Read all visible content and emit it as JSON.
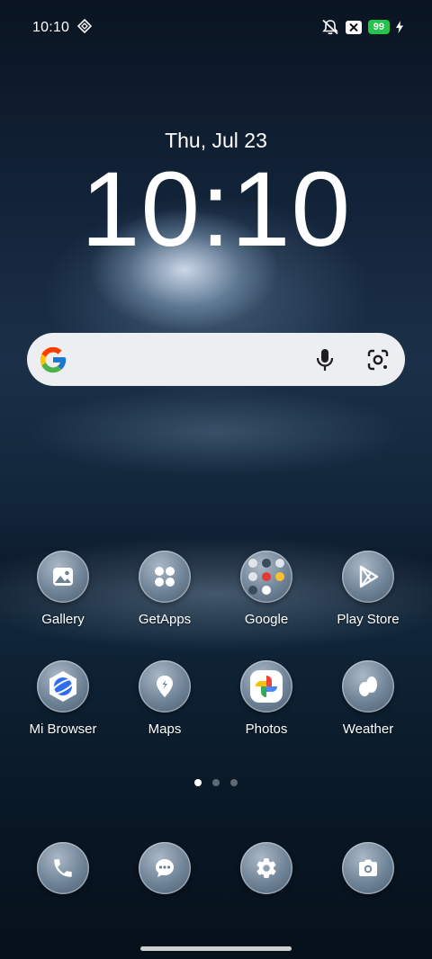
{
  "status_bar": {
    "time": "10:10",
    "battery_level": "99",
    "battery_color": "#27c24c"
  },
  "lockscreen": {
    "date": "Thu, Jul 23",
    "clock": "10:10"
  },
  "search": {
    "provider": "Google",
    "icons": [
      "google-g-icon",
      "microphone-icon",
      "google-lens-icon"
    ]
  },
  "apps": [
    {
      "label": "Gallery",
      "icon": "gallery-icon"
    },
    {
      "label": "GetApps",
      "icon": "getapps-icon"
    },
    {
      "label": "Google",
      "icon": "folder-icon"
    },
    {
      "label": "Play Store",
      "icon": "play-store-icon"
    },
    {
      "label": "Mi Browser",
      "icon": "mi-browser-icon"
    },
    {
      "label": "Maps",
      "icon": "maps-icon"
    },
    {
      "label": "Photos",
      "icon": "photos-icon"
    },
    {
      "label": "Weather",
      "icon": "weather-icon"
    }
  ],
  "pages": {
    "count": 3,
    "active": 1
  },
  "dock": [
    {
      "name": "phone",
      "icon": "phone-icon"
    },
    {
      "name": "messages",
      "icon": "messages-icon"
    },
    {
      "name": "settings",
      "icon": "settings-icon"
    },
    {
      "name": "camera",
      "icon": "camera-icon"
    }
  ]
}
